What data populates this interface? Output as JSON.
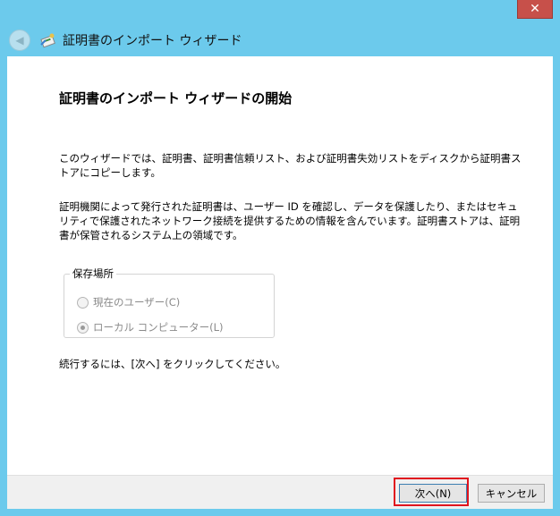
{
  "window": {
    "title": "証明書のインポート ウィザード",
    "close_label": "✕"
  },
  "content": {
    "heading": "証明書のインポート ウィザードの開始",
    "paragraph1": "このウィザードでは、証明書、証明書信頼リスト、および証明書失効リストをディスクから証明書ストアにコピーします。",
    "paragraph2": "証明機関によって発行された証明書は、ユーザー ID を確認し、データを保護したり、またはセキュリティで保護されたネットワーク接続を提供するための情報を含んでいます。証明書ストアは、証明書が保管されるシステム上の領域です。",
    "store_group": {
      "legend": "保存場所",
      "options": [
        {
          "label": "現在のユーザー(C)",
          "checked": false,
          "enabled": false
        },
        {
          "label": "ローカル コンピューター(L)",
          "checked": true,
          "enabled": false
        }
      ]
    },
    "paragraph3": "続行するには、[次へ] をクリックしてください。"
  },
  "footer": {
    "next_label": "次へ(N)",
    "cancel_label": "キャンセル"
  },
  "colors": {
    "frame": "#6ccaec",
    "close": "#c7504a",
    "highlight": "#e0141e"
  },
  "icons": {
    "back": "back-arrow-icon",
    "wizard": "certificate-wizard-icon"
  }
}
